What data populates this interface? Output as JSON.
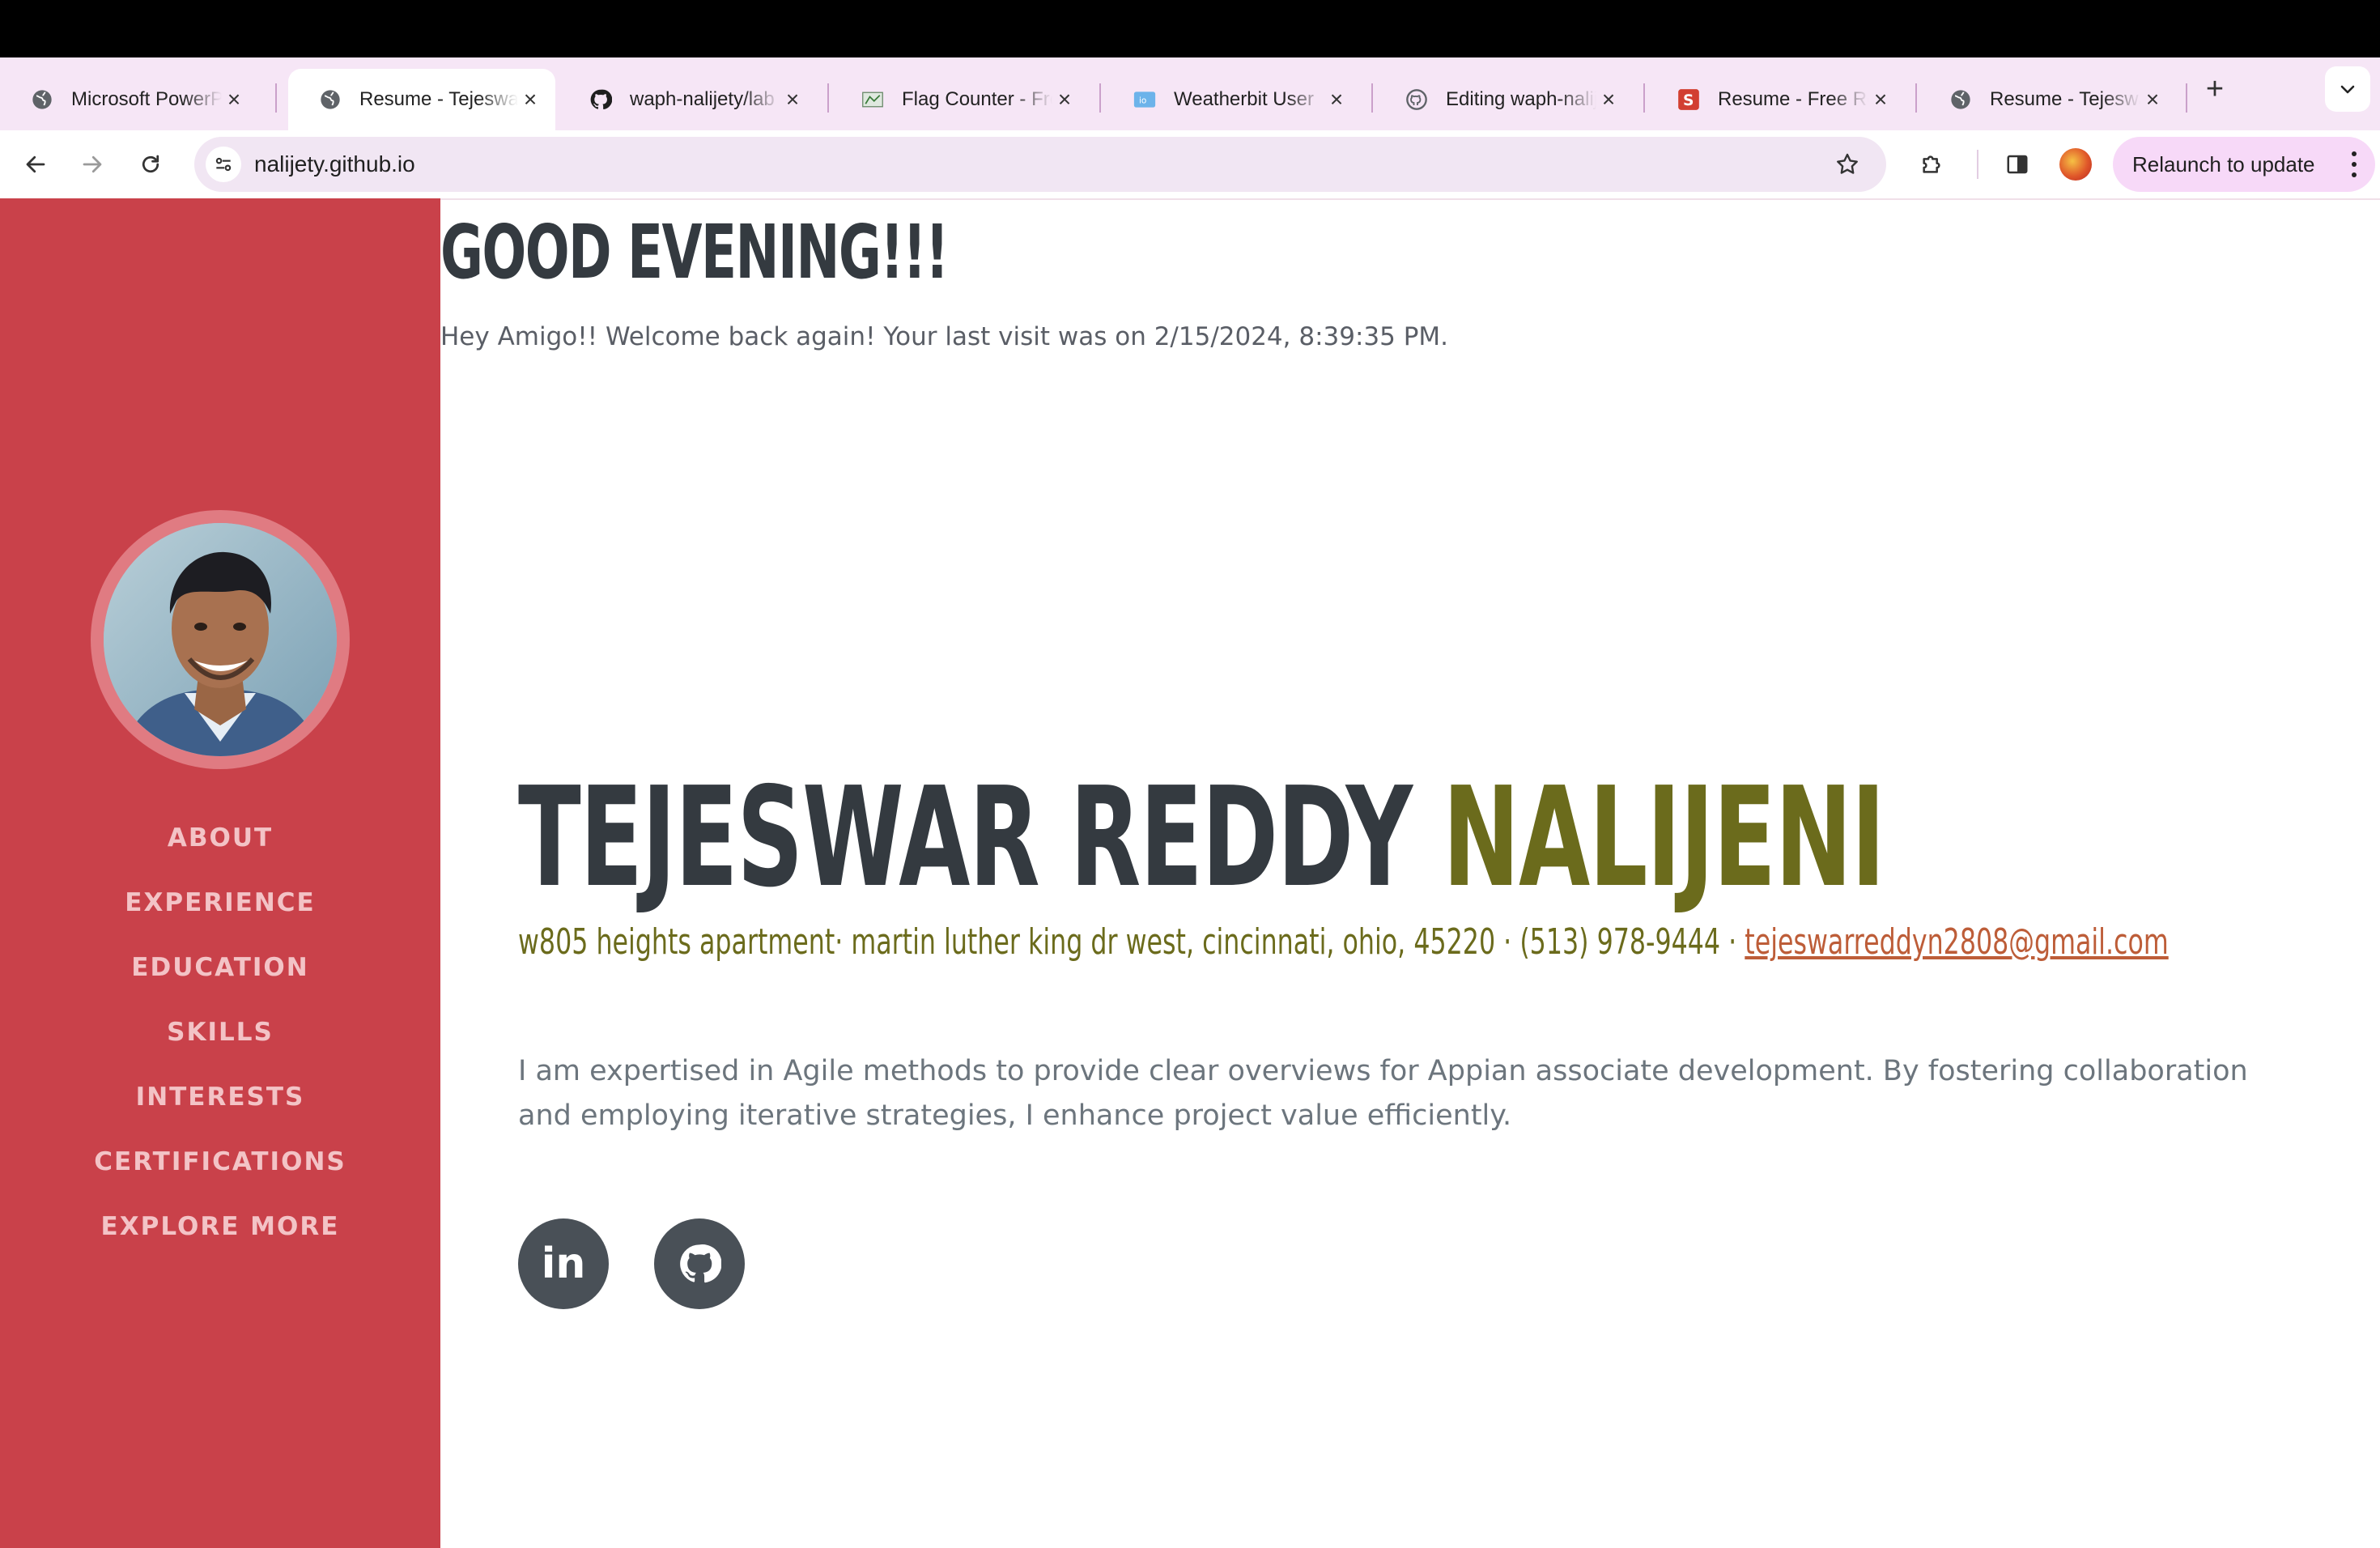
{
  "browser": {
    "tabs": [
      {
        "title": "Microsoft PowerPoint",
        "favicon": "globe-icon",
        "active": false
      },
      {
        "title": "Resume - Tejeswar",
        "favicon": "globe-icon",
        "active": true
      },
      {
        "title": "waph-nalijety/lab",
        "favicon": "github-icon",
        "active": false
      },
      {
        "title": "Flag Counter - Free",
        "favicon": "flag-counter-icon",
        "active": false
      },
      {
        "title": "Weatherbit User",
        "favicon": "weatherbit-icon",
        "active": false
      },
      {
        "title": "Editing waph-nalijety",
        "favicon": "github-outline-icon",
        "active": false
      },
      {
        "title": "Resume - Free Resume",
        "favicon": "s-logo-icon",
        "active": false
      },
      {
        "title": "Resume - Tejeswar",
        "favicon": "globe-icon",
        "active": false
      }
    ],
    "url": "nalijety.github.io",
    "relaunch_label": "Relaunch to update",
    "accent": "#f7d9f8"
  },
  "page": {
    "greeting": "GOOD EVENING!!!",
    "visit_message": "Hey Amigo!! Welcome back again! Your last visit was on 2/15/2024, 8:39:35 PM.",
    "name_first": "TEJESWAR REDDY",
    "name_last": "NALIJENI",
    "address": "w805 heights apartment· martin luther king dr west, cincinnati, ohio, 45220 · (513) 978-9444 · ",
    "email": "tejeswarreddyn2808@gmail.com",
    "summary": "I am expertised in Agile methods to provide clear overviews for Appian associate development. By fostering collaboration and employing iterative strategies, I enhance project value efficiently.",
    "social": [
      {
        "icon": "linkedin-icon",
        "text": "in"
      },
      {
        "icon": "github-icon"
      }
    ]
  },
  "sidebar": {
    "color": "#c9414a",
    "nav": [
      "ABOUT",
      "EXPERIENCE",
      "EDUCATION",
      "SKILLS",
      "INTERESTS",
      "CERTIFICATIONS",
      "EXPLORE MORE"
    ]
  }
}
